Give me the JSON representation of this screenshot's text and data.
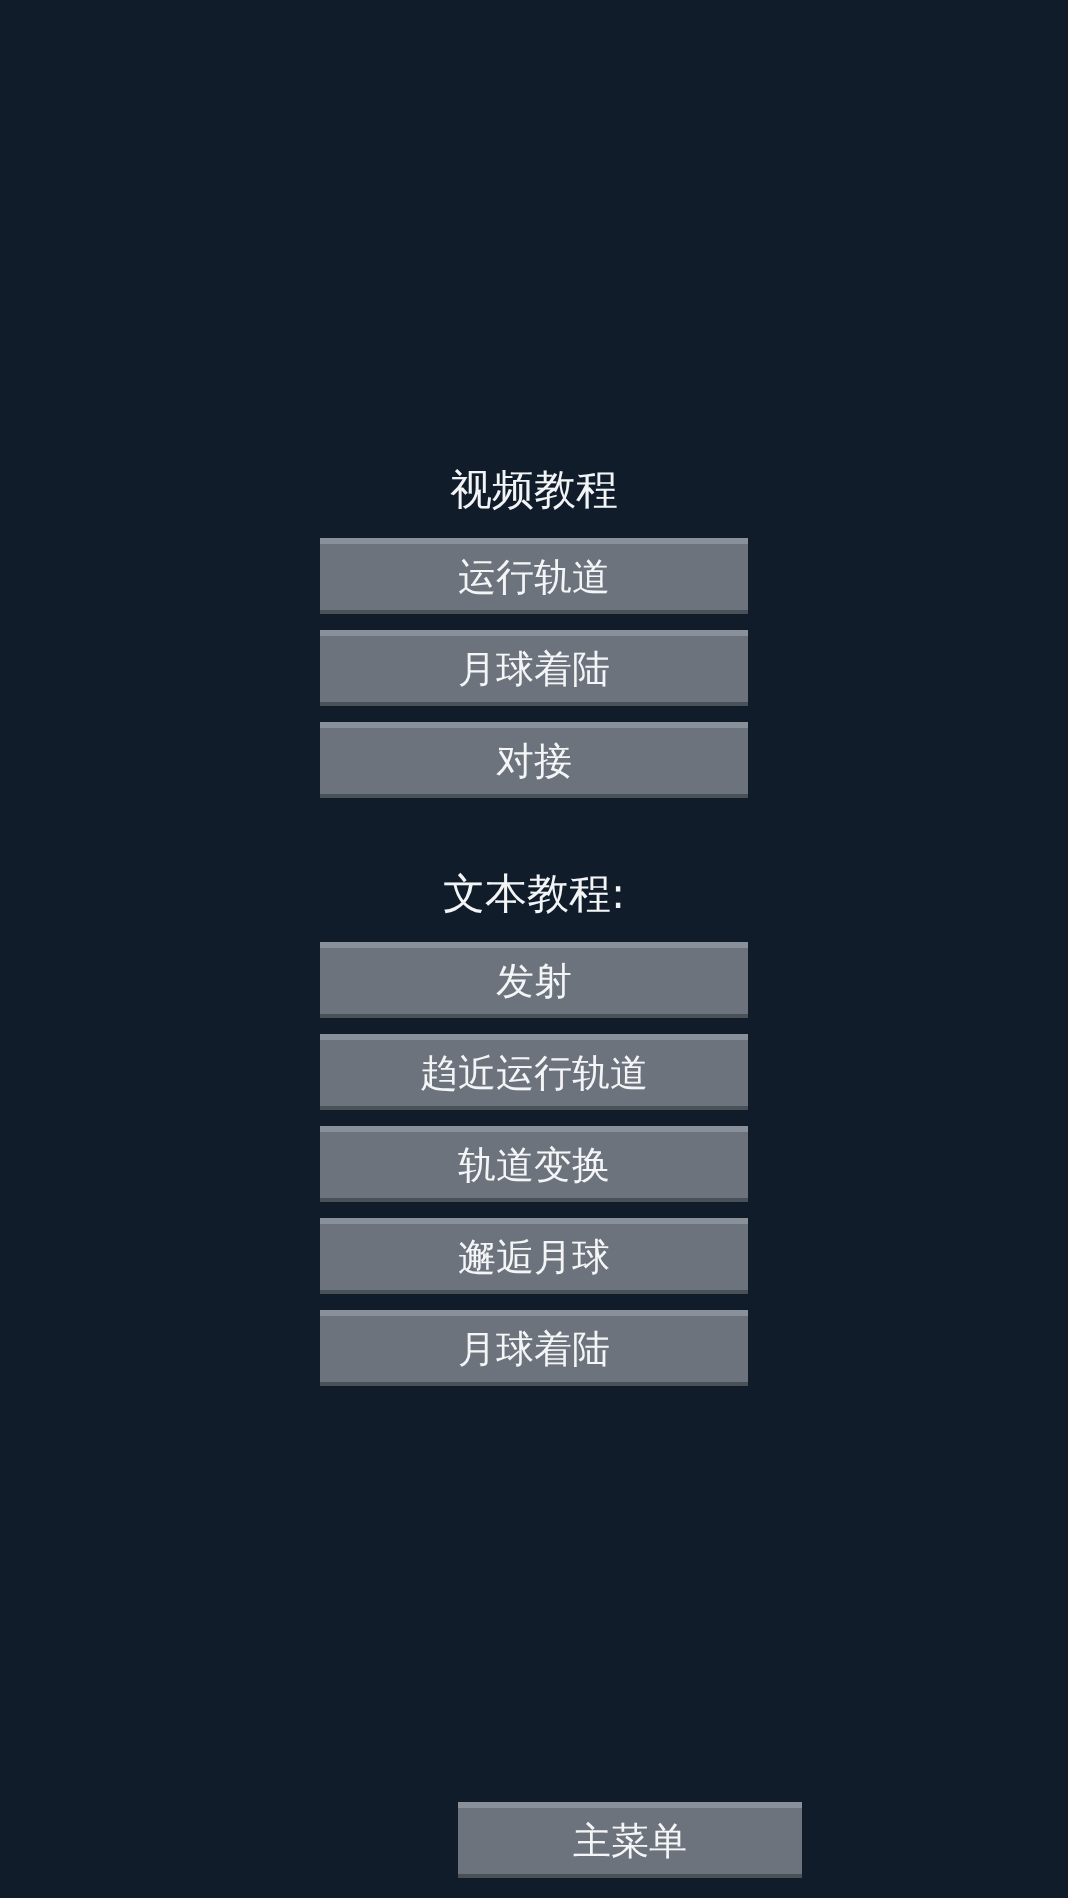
{
  "sections": [
    {
      "title": "视频教程",
      "buttons": [
        "运行轨道",
        "月球着陆",
        "对接"
      ]
    },
    {
      "title": "文本教程:",
      "buttons": [
        "发射",
        "趋近运行轨道",
        "轨道变换",
        "邂逅月球",
        "月球着陆"
      ]
    }
  ],
  "main_menu_button": "主菜单"
}
